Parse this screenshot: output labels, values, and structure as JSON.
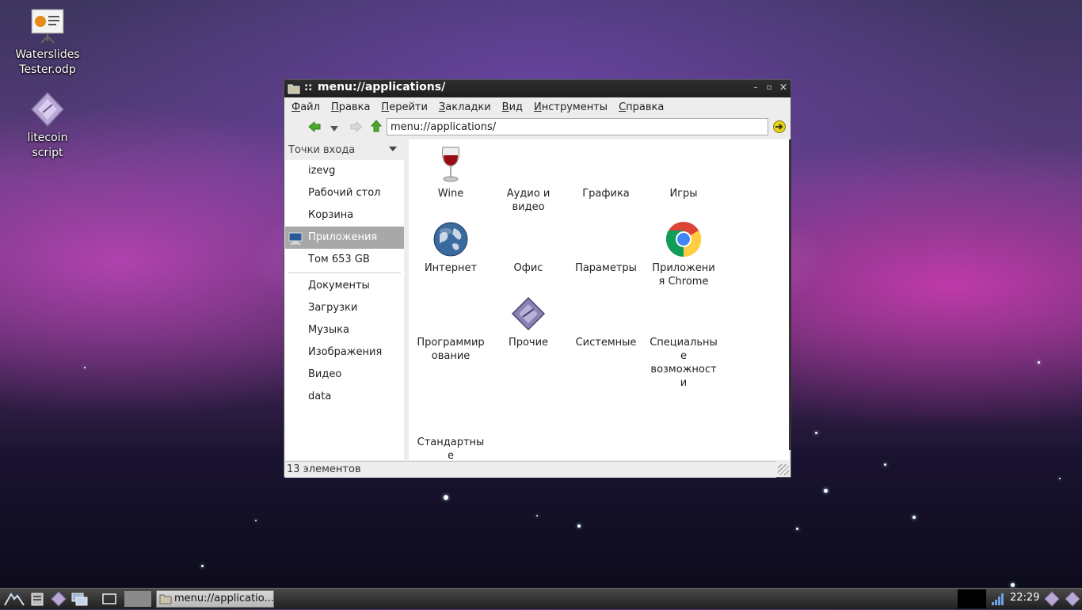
{
  "desktop": {
    "icons": [
      {
        "name": "Waterslides Tester.odp",
        "line1": "Waterslides",
        "line2": "Tester.odp",
        "icon": "presentation-file-icon"
      },
      {
        "name": "litecoin script",
        "line1": "litecoin",
        "line2": "script",
        "icon": "script-diamond-icon"
      }
    ]
  },
  "window": {
    "title": "menu://applications/",
    "title_sep": "::",
    "controls": {
      "minimize": "–",
      "maximize": "▫",
      "close": "×"
    },
    "menu": [
      {
        "accel": "Ф",
        "rest": "айл"
      },
      {
        "accel": "П",
        "rest": "равка"
      },
      {
        "accel": "П",
        "rest": "ерейти"
      },
      {
        "accel": "З",
        "rest": "акладки"
      },
      {
        "accel": "В",
        "rest": "ид"
      },
      {
        "accel": "И",
        "rest": "нструменты"
      },
      {
        "accel": "С",
        "rest": "правка"
      }
    ],
    "address": "menu://applications/",
    "sidebar": {
      "header": "Точки входа",
      "places": [
        "izevg",
        "Рабочий стол",
        "Корзина",
        "Приложения",
        "Том 653 GB"
      ],
      "selected": "Приложения",
      "bookmarks": [
        "Документы",
        "Загрузки",
        "Музыка",
        "Изображения",
        "Видео",
        "data"
      ]
    },
    "apps": [
      {
        "l1": "Wine",
        "l2": "",
        "icon": "wine-glass-icon"
      },
      {
        "l1": "Аудио и",
        "l2": "видео",
        "icon": ""
      },
      {
        "l1": "Графика",
        "l2": "",
        "icon": ""
      },
      {
        "l1": "Игры",
        "l2": "",
        "icon": ""
      },
      {
        "l1": "Интернет",
        "l2": "",
        "icon": "globe-icon"
      },
      {
        "l1": "Офис",
        "l2": "",
        "icon": ""
      },
      {
        "l1": "Параметры",
        "l2": "",
        "icon": ""
      },
      {
        "l1": "Приложени",
        "l2": "я Chrome",
        "icon": "chrome-icon"
      },
      {
        "l1": "Программир",
        "l2": "ование",
        "icon": ""
      },
      {
        "l1": "Прочие",
        "l2": "",
        "icon": "misc-diamond-icon"
      },
      {
        "l1": "Системные",
        "l2": "",
        "icon": ""
      },
      {
        "l1": "Специальны",
        "l2": "е",
        "l3": "возможност",
        "l4": "и",
        "icon": ""
      },
      {
        "l1": "Стандартны",
        "l2": "е",
        "icon": ""
      }
    ],
    "status": "13 элементов"
  },
  "panel": {
    "task_label": "menu://applicatio...",
    "clock": "22:29"
  }
}
